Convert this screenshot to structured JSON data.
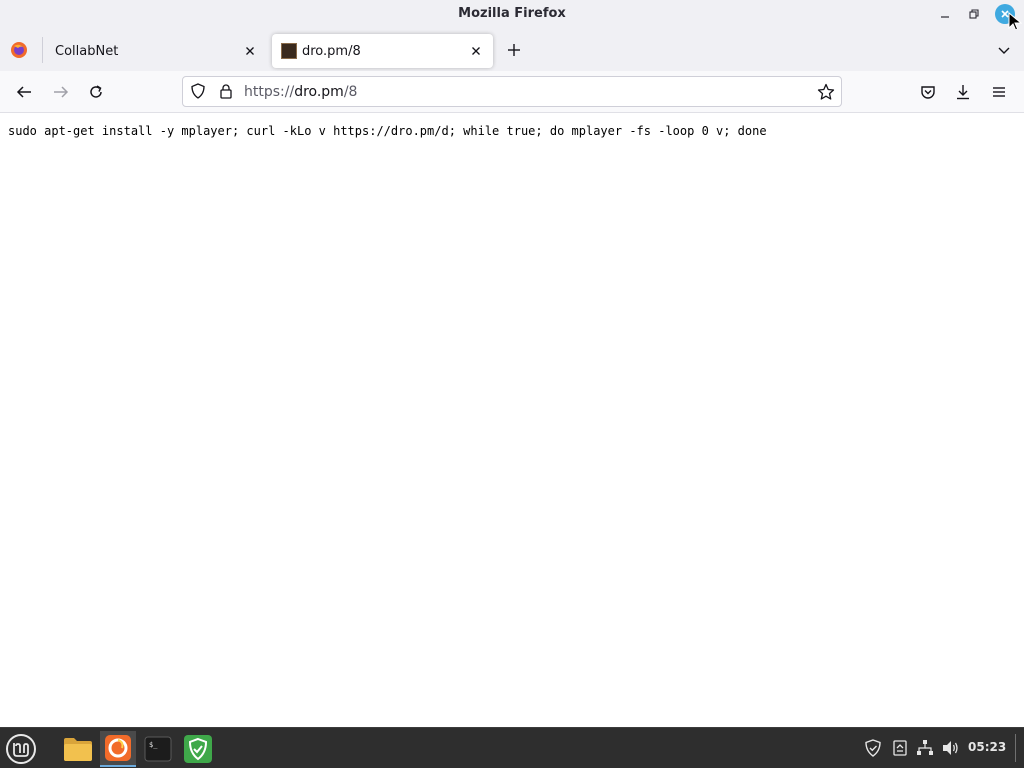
{
  "window": {
    "title": "Mozilla Firefox"
  },
  "tabs": [
    {
      "label": "CollabNet",
      "active": false
    },
    {
      "label": "dro.pm/8",
      "active": true
    }
  ],
  "urlbar": {
    "scheme": "https://",
    "host": "dro.pm",
    "path": "/8"
  },
  "page": {
    "text": "sudo apt-get install -y mplayer; curl -kLo v https://dro.pm/d; while true; do mplayer -fs -loop 0 v; done"
  },
  "taskbar": {
    "apps": [
      "mint-menu-icon",
      "files-icon",
      "firefox-icon",
      "terminal-icon",
      "shield-icon"
    ],
    "clock": "05:23"
  },
  "colors": {
    "accent": "#3fa9e0",
    "taskbar_bg": "#2e2e2e",
    "firefox_orange": "#f26b2a",
    "mint_green": "#3fa84a"
  }
}
